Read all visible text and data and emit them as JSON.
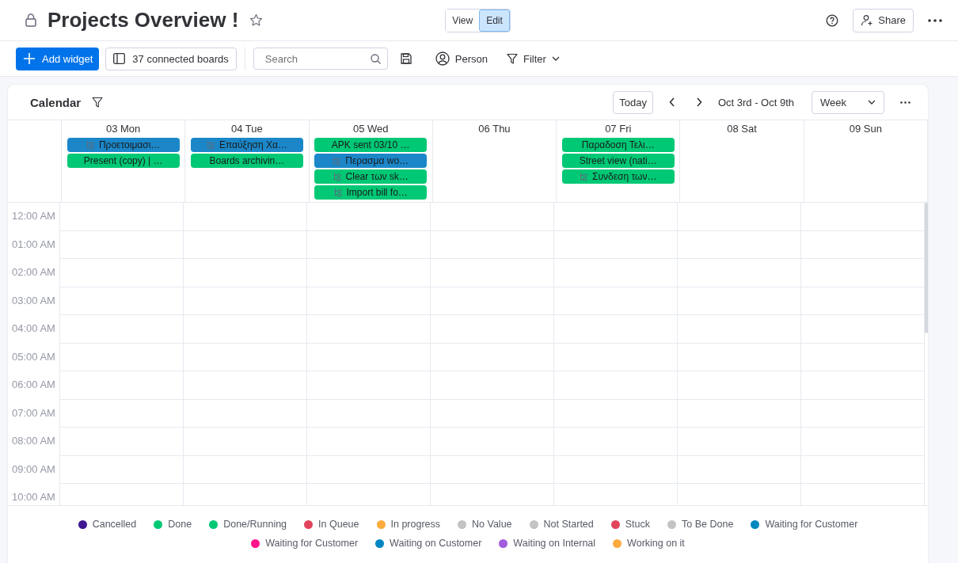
{
  "header": {
    "title": "Projects Overview !",
    "mode_toggle": [
      {
        "label": "View",
        "selected": false
      },
      {
        "label": "Edit",
        "selected": true
      }
    ],
    "share": "Share"
  },
  "toolbar": {
    "add_widget": "Add widget",
    "connected_boards": "37 connected boards",
    "search": {
      "placeholder": "Search"
    },
    "person": "Person",
    "filter": "Filter"
  },
  "calendar": {
    "title": "Calendar",
    "today": "Today",
    "range": "Oct 3rd - Oct 9th",
    "view": "Week",
    "days": [
      {
        "label": "03 Mon",
        "events": [
          {
            "text": "Προετοιμασι…",
            "subitem": true,
            "color": "#1b87c9"
          },
          {
            "text": "Present (copy) | …",
            "subitem": false,
            "color": "#00c875"
          }
        ]
      },
      {
        "label": "04 Tue",
        "events": [
          {
            "text": "Επαύξηση Χα…",
            "subitem": true,
            "color": "#1b87c9"
          },
          {
            "text": "Boards archivin…",
            "subitem": false,
            "color": "#00c875"
          }
        ]
      },
      {
        "label": "05 Wed",
        "events": [
          {
            "text": "APK sent 03/10 …",
            "subitem": false,
            "color": "#00c875"
          },
          {
            "text": "Περασμα wo…",
            "subitem": true,
            "color": "#1b87c9"
          },
          {
            "text": "Clear των sk…",
            "subitem": true,
            "color": "#00c875"
          },
          {
            "text": "Import bill fo…",
            "subitem": true,
            "color": "#00c875"
          }
        ]
      },
      {
        "label": "06 Thu"
      },
      {
        "label": "07 Fri",
        "events": [
          {
            "text": "Παραδοση Τελι…",
            "subitem": false,
            "color": "#00c875"
          },
          {
            "text": "Street view (nati…",
            "subitem": false,
            "color": "#00c875"
          },
          {
            "text": "Συνδεση των…",
            "subitem": true,
            "color": "#00c875"
          }
        ]
      },
      {
        "label": "08 Sat"
      },
      {
        "label": "09 Sun"
      }
    ],
    "hours": [
      "12:00 AM",
      "01:00 AM",
      "02:00 AM",
      "03:00 AM",
      "04:00 AM",
      "05:00 AM",
      "06:00 AM",
      "07:00 AM",
      "08:00 AM",
      "09:00 AM",
      "10:00 AM"
    ]
  },
  "legend": [
    {
      "label": "Cancelled",
      "color": "#401694"
    },
    {
      "label": "Done",
      "color": "#00c875"
    },
    {
      "label": "Done/Running",
      "color": "#00c875"
    },
    {
      "label": "In Queue",
      "color": "#e2445c"
    },
    {
      "label": "In progress",
      "color": "#fdab3d"
    },
    {
      "label": "No Value",
      "color": "#c4c4c4"
    },
    {
      "label": "Not Started",
      "color": "#c4c4c4"
    },
    {
      "label": "Stuck",
      "color": "#e2445c"
    },
    {
      "label": "To Be Done",
      "color": "#c4c4c4"
    },
    {
      "label": "Waiting for Customer",
      "color": "#0086c0"
    },
    {
      "label": "Waiting for Customer",
      "color": "#ff158a"
    },
    {
      "label": "Waiting on Customer",
      "color": "#0086c0"
    },
    {
      "label": "Waiting on Internal",
      "color": "#a25ddc"
    },
    {
      "label": "Working on it",
      "color": "#fdab3d"
    }
  ]
}
